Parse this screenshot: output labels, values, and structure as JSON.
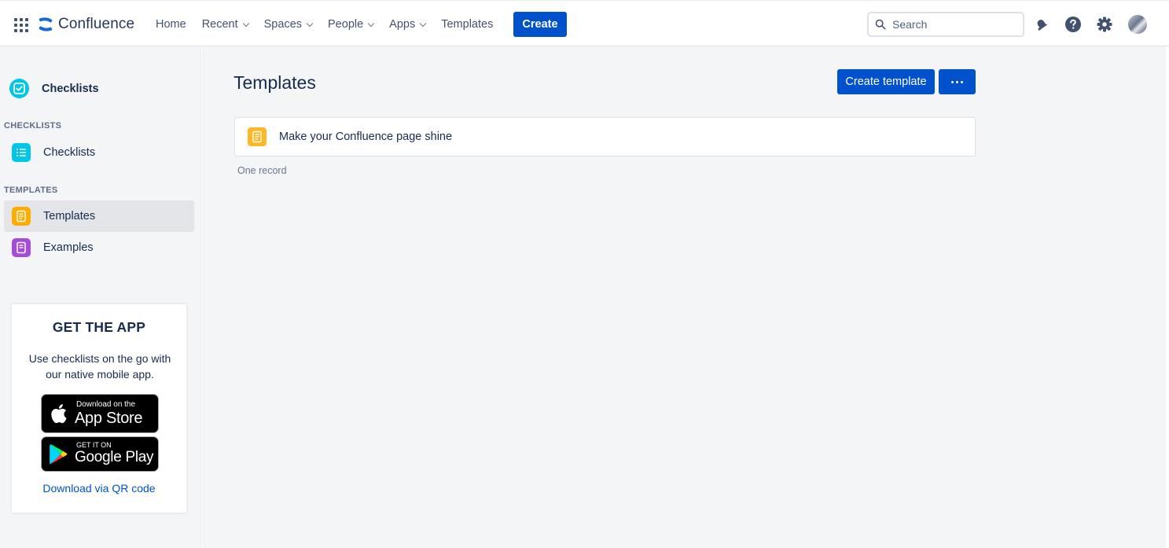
{
  "topnav": {
    "app_switcher_icon": "grid-icon",
    "logo_text": "Confluence",
    "items": [
      {
        "label": "Home",
        "dropdown": false
      },
      {
        "label": "Recent",
        "dropdown": true
      },
      {
        "label": "Spaces",
        "dropdown": true
      },
      {
        "label": "People",
        "dropdown": true
      },
      {
        "label": "Apps",
        "dropdown": true
      },
      {
        "label": "Templates",
        "dropdown": false
      }
    ],
    "create_label": "Create",
    "search_placeholder": "Search",
    "icons": [
      "notifications-icon",
      "help-icon",
      "settings-icon",
      "avatar"
    ]
  },
  "sidebar": {
    "app_name": "Checklists",
    "sections": [
      {
        "title": "CHECKLISTS",
        "items": [
          {
            "label": "Checklists",
            "icon": "checklist-icon",
            "color": "#00c7e6",
            "active": false
          }
        ]
      },
      {
        "title": "TEMPLATES",
        "items": [
          {
            "label": "Templates",
            "icon": "document-icon",
            "color": "#ffab00",
            "active": true
          },
          {
            "label": "Examples",
            "icon": "examples-icon",
            "color": "#a54bdb",
            "active": false
          }
        ]
      }
    ],
    "app_card": {
      "title": "GET THE APP",
      "description": "Use checklists on the go with our native mobile app.",
      "app_store": {
        "small": "Download on the",
        "big": "App Store"
      },
      "google_play": {
        "small": "GET IT ON",
        "big": "Google Play"
      },
      "qr_link": "Download via QR code"
    }
  },
  "main": {
    "title": "Templates",
    "create_template_label": "Create template",
    "records": [
      {
        "label": "Make your Confluence page shine"
      }
    ],
    "record_count": "One record"
  },
  "colors": {
    "brand_blue": "#0052cc",
    "teal": "#00c7e6",
    "orange": "#ffab00",
    "purple": "#a54bdb"
  }
}
